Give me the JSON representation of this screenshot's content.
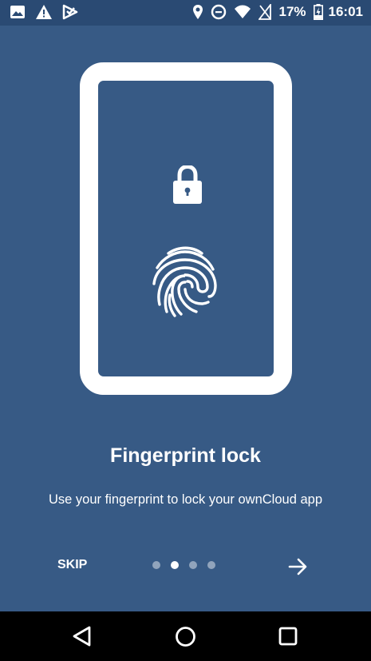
{
  "status_bar": {
    "battery_percent": "17%",
    "time": "16:01",
    "left_icons": [
      "image-notification-icon",
      "warning-icon",
      "download-check-icon"
    ],
    "right_icons": [
      "location-icon",
      "data-saver-icon",
      "wifi-icon",
      "no-sim-icon",
      "battery-charging-icon"
    ]
  },
  "illustration": {
    "icons": [
      "phone-outline-icon",
      "lock-icon",
      "fingerprint-icon"
    ]
  },
  "onboarding": {
    "title": "Fingerprint lock",
    "subtitle": "Use your fingerprint to lock your ownCloud app",
    "skip_label": "SKIP",
    "current_page": 2,
    "total_pages": 4
  },
  "nav_bar": {
    "icons": [
      "back-icon",
      "home-icon",
      "recents-icon"
    ]
  },
  "colors": {
    "background": "#375a85",
    "status_bar": "#2a4a73",
    "foreground": "#ffffff"
  }
}
